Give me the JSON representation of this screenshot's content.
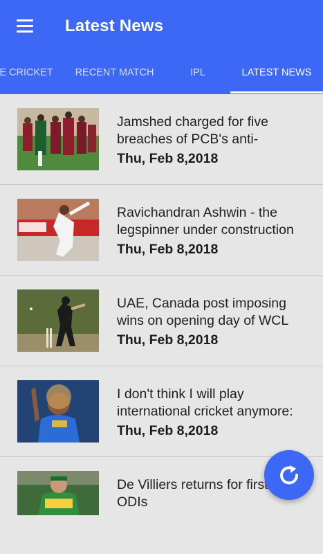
{
  "appbar": {
    "title": "Latest News",
    "menu_icon": "hamburger-menu-icon",
    "color": "#3d67f5"
  },
  "tabs": [
    {
      "label": "E CRICKET",
      "active": false
    },
    {
      "label": "RECENT MATCH",
      "active": false
    },
    {
      "label": "IPL",
      "active": false
    },
    {
      "label": "LATEST NEWS",
      "active": true
    }
  ],
  "news": [
    {
      "headline": "Jamshed charged for five breaches of PCB's anti-",
      "date": "Thu, Feb 8,2018",
      "thumbnail": "cricket-team-celebration-photo"
    },
    {
      "headline": "Ravichandran Ashwin - the legspinner under construction",
      "date": "Thu, Feb 8,2018",
      "thumbnail": "bowler-action-photo"
    },
    {
      "headline": "UAE, Canada post imposing wins on opening day of WCL",
      "date": "Thu, Feb 8,2018",
      "thumbnail": "batsman-shot-photo"
    },
    {
      "headline": "I don't think I will play international cricket anymore:",
      "date": "Thu, Feb 8,2018",
      "thumbnail": "player-pointing-photo"
    },
    {
      "headline": "De Villiers returns for first three ODIs",
      "date": "",
      "thumbnail": "player-portrait-photo"
    }
  ],
  "fab": {
    "icon": "refresh-icon"
  }
}
